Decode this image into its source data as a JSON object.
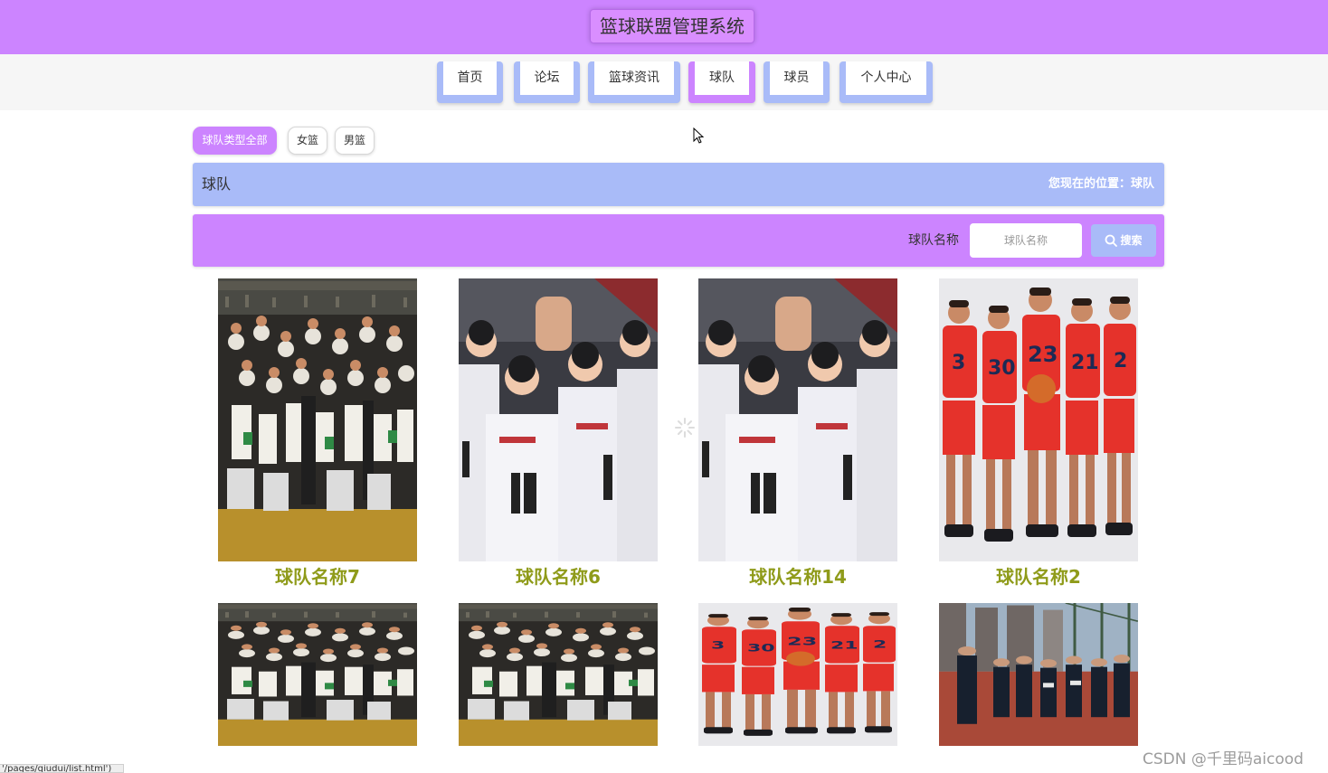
{
  "header": {
    "site_title": "篮球联盟管理系统"
  },
  "nav": {
    "items": [
      {
        "label": "首页",
        "active": false
      },
      {
        "label": "论坛",
        "active": false
      },
      {
        "label": "篮球资讯",
        "active": false
      },
      {
        "label": "球队",
        "active": true
      },
      {
        "label": "球员",
        "active": false
      },
      {
        "label": "个人中心",
        "active": false
      }
    ]
  },
  "filters": {
    "items": [
      {
        "label": "球队类型全部",
        "active": true
      },
      {
        "label": "女篮",
        "active": false
      },
      {
        "label": "男篮",
        "active": false
      }
    ]
  },
  "breadcrumb": {
    "title": "球队",
    "location": "您现在的位置：球队"
  },
  "search": {
    "label": "球队名称",
    "placeholder": "球队名称",
    "value": "",
    "button_label": "搜索",
    "icon": "search-icon"
  },
  "teams": [
    {
      "name": "球队名称7",
      "image": "celtics-championship-celebration"
    },
    {
      "name": "球队名称6",
      "image": "cba-team-huddle"
    },
    {
      "name": "球队名称14",
      "image": "cba-team-huddle"
    },
    {
      "name": "球队名称2",
      "image": "cleveland-players-red-jerseys"
    },
    {
      "name": "",
      "image": "celtics-championship-celebration"
    },
    {
      "name": "",
      "image": "celtics-championship-celebration"
    },
    {
      "name": "",
      "image": "cleveland-players-red-jerseys"
    },
    {
      "name": "",
      "image": "outdoor-court-team-group"
    }
  ],
  "status_bar": {
    "url": "'/pages/qiudui/list.html')"
  },
  "watermark": "CSDN @千里码aicood",
  "colors": {
    "header_bg": "#cc84ff",
    "nav_accent": "#a9bbf8",
    "nav_active": "#cc84ff",
    "breadcrumb_bg": "#a9bbf8",
    "search_bg": "#cc84ff",
    "team_name": "#8f9b1a"
  }
}
